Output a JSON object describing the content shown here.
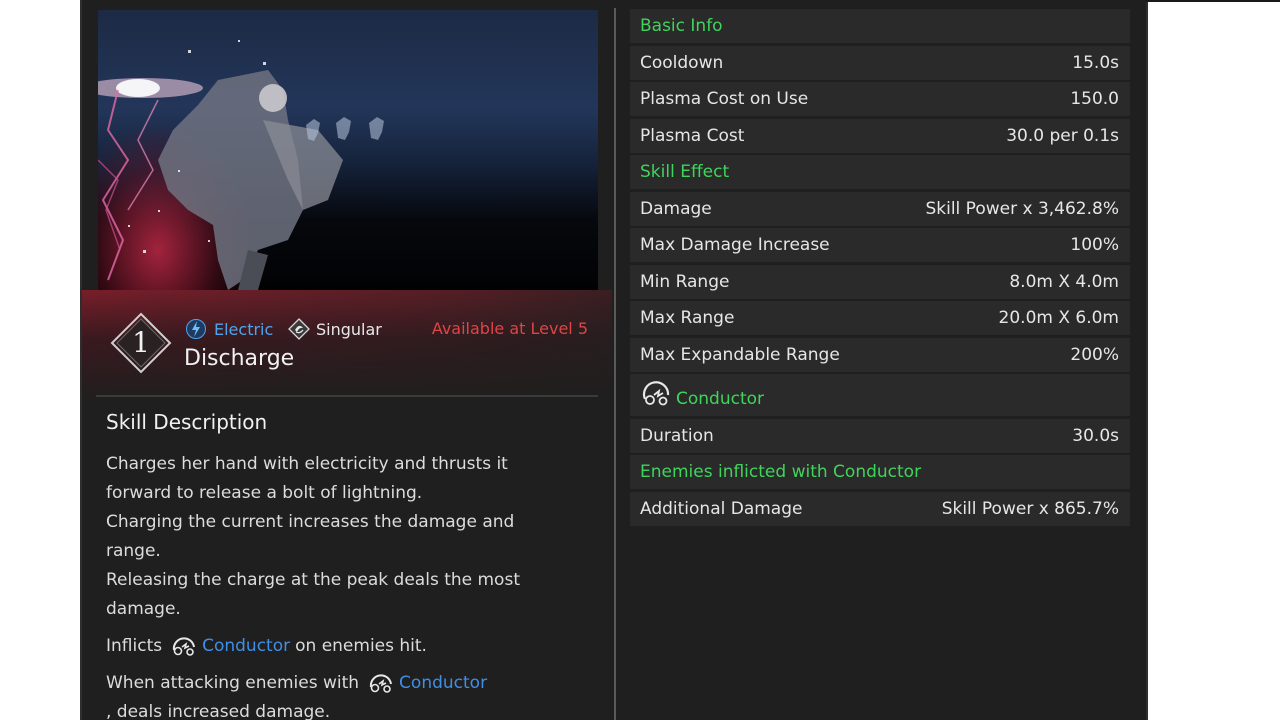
{
  "skill": {
    "number": "1",
    "element_label": "Electric",
    "type_label": "Singular",
    "availability": "Available at Level 5",
    "name": "Discharge"
  },
  "description": {
    "title": "Skill Description",
    "lines": [
      "Charges her hand with electricity and thrusts it forward to release a bolt of lightning.",
      "Charging the current increases the damage and range.",
      "Releasing the charge at the peak deals the most damage."
    ],
    "inflict_prefix": "Inflicts",
    "inflict_link": "Conductor",
    "inflict_suffix": "on enemies hit.",
    "attack_prefix": "When attacking enemies with",
    "attack_link": "Conductor",
    "attack_suffix": ", deals increased damage."
  },
  "stats": {
    "basic_info": "Basic Info",
    "cooldown_label": "Cooldown",
    "cooldown_value": "15.0s",
    "plasma_use_label": "Plasma Cost on Use",
    "plasma_use_value": "150.0",
    "plasma_cost_label": "Plasma Cost",
    "plasma_cost_value": "30.0 per 0.1s",
    "skill_effect": "Skill Effect",
    "damage_label": "Damage",
    "damage_value": "Skill Power x 3,462.8%",
    "max_dmg_inc_label": "Max Damage Increase",
    "max_dmg_inc_value": "100%",
    "min_range_label": "Min Range",
    "min_range_value": "8.0m X 4.0m",
    "max_range_label": "Max Range",
    "max_range_value": "20.0m X 6.0m",
    "max_exp_label": "Max Expandable Range",
    "max_exp_value": "200%",
    "conductor_label": "Conductor",
    "duration_label": "Duration",
    "duration_value": "30.0s",
    "inflicted_label": "Enemies inflicted with Conductor",
    "add_dmg_label": "Additional Damage",
    "add_dmg_value": "Skill Power x 865.7%"
  },
  "colors": {
    "section_green": "#3fd45c",
    "electric_blue": "#4fa4ee",
    "link_blue": "#3f8fe6",
    "availability_red": "#e04444",
    "row_bg": "#2a2a2a",
    "panel_bg": "#1f1f1f"
  },
  "icons": {
    "element": "lightning-bolt-icon",
    "type": "diamond-swirl-icon",
    "status": "conductor-shock-icon"
  }
}
